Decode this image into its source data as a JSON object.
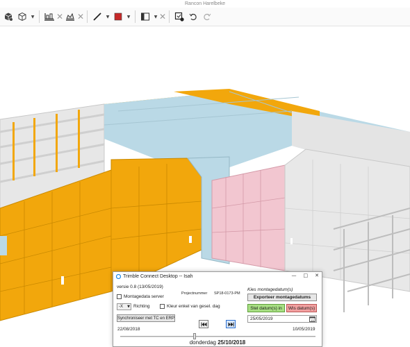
{
  "window": {
    "title": "Rancon Harelbeke"
  },
  "toolbar": {
    "tools": [
      {
        "icon": "models-icon"
      },
      {
        "icon": "cube-icon"
      },
      {
        "icon": "dropdown-caret-icon"
      },
      {
        "icon": "section-plane-icon"
      },
      {
        "icon": "clear-icon"
      },
      {
        "icon": "section-box-icon"
      },
      {
        "icon": "clear-icon"
      },
      {
        "icon": "measure-icon"
      },
      {
        "icon": "dropdown-caret-icon"
      },
      {
        "icon": "color-icon"
      },
      {
        "icon": "dropdown-caret-icon"
      },
      {
        "icon": "panel-icon"
      },
      {
        "icon": "dropdown-caret-icon"
      },
      {
        "icon": "clear-icon"
      },
      {
        "icon": "edit-view-icon"
      },
      {
        "icon": "undo-icon"
      },
      {
        "icon": "redo-icon"
      }
    ],
    "active_color": "#c62828"
  },
  "colors": {
    "orange": "#f2a70c",
    "blue": "#bad9e6",
    "pink": "#f2c6d0",
    "grey": "#e0e0e0"
  },
  "dialog": {
    "title": "Trimble Connect Desktop -- Isah",
    "version": "versie 0.8 (13/05/2019)",
    "project_label": "Projectnummer",
    "project_number": "SP18-0173-PM",
    "pick_label": "Kies montagedatum(s)",
    "export_button": "Exporteer montagedatums",
    "server_checkbox": "Montagedata server",
    "direction_value": "-X",
    "direction_label": "Richting",
    "color_only_checkbox": "Kleur enkel van gesel. dag",
    "set_date_button": "Stel datum(s) in",
    "clear_date_button": "Wis datum(s)",
    "date_value": "25/05/2019",
    "sync_button": "Synchroniseer met TC en ERP",
    "start_date": "22/08/2018",
    "end_date": "10/05/2019",
    "current_day": "donderdag",
    "current_date": "25/10/2018",
    "slider_position": 0.38
  }
}
